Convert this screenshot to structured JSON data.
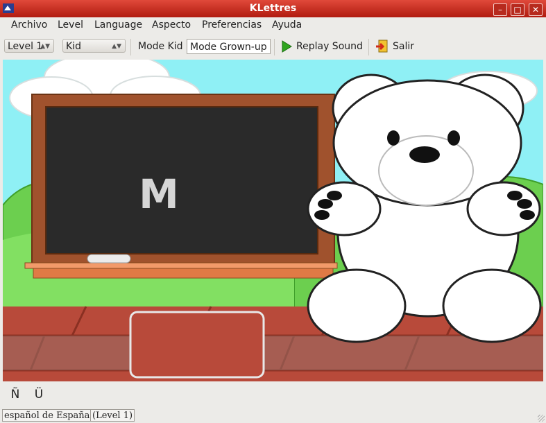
{
  "window": {
    "title": "KLettres"
  },
  "menu": [
    "Archivo",
    "Level",
    "Language",
    "Aspecto",
    "Preferencias",
    "Ayuda"
  ],
  "toolbar": {
    "level_combo": "Level 1",
    "look_combo": "Kid",
    "mode_kid": "Mode Kid",
    "mode_grownup": "Mode Grown-up",
    "replay": "Replay Sound",
    "quit": "Salir"
  },
  "board": {
    "letter": "M"
  },
  "special_chars": [
    "Ñ",
    "Ü"
  ],
  "status": {
    "language": "español de España",
    "level": "(Level 1)"
  },
  "colors": {
    "titlebar": "#c8281b",
    "sky": "#8ff0f5",
    "board": "#2a2a2a",
    "frame": "#a0522d",
    "ground": "#b84a3a"
  },
  "icons": [
    "app-icon",
    "minimize-icon",
    "maximize-icon",
    "close-icon",
    "play-icon",
    "exit-icon"
  ]
}
